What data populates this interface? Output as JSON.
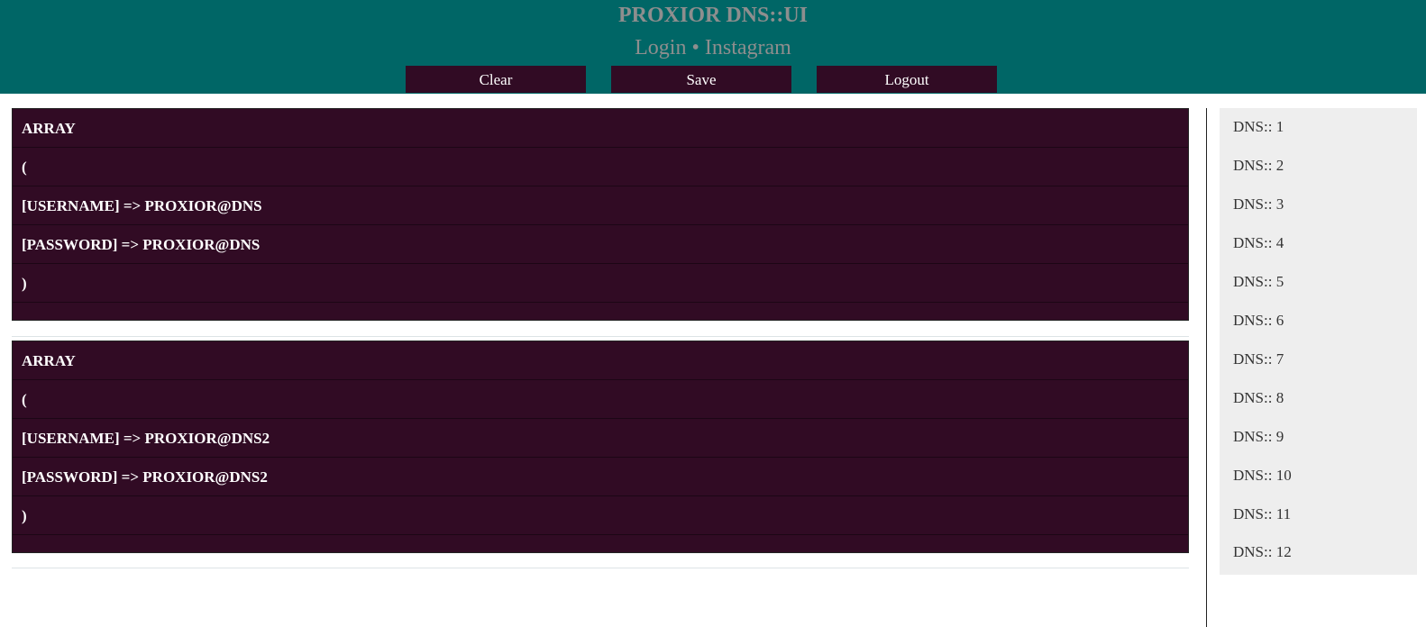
{
  "header": {
    "title": "PROXIOR DNS::UI",
    "subtitle": "Login • Instagram",
    "buttons": {
      "clear": "Clear",
      "save": "Save",
      "logout": "Logout"
    }
  },
  "records": [
    {
      "lines": [
        "ARRAY",
        "(",
        "[USERNAME] => PROXIOR@DNS",
        "[PASSWORD] => PROXIOR@DNS",
        ")"
      ]
    },
    {
      "lines": [
        "ARRAY",
        "(",
        "[USERNAME] => PROXIOR@DNS2",
        "[PASSWORD] => PROXIOR@DNS2",
        ")"
      ]
    }
  ],
  "sidebar": {
    "items": [
      "DNS:: 1",
      "DNS:: 2",
      "DNS:: 3",
      "DNS:: 4",
      "DNS:: 5",
      "DNS:: 6",
      "DNS:: 7",
      "DNS:: 8",
      "DNS:: 9",
      "DNS:: 10",
      "DNS:: 11",
      "DNS:: 12"
    ]
  },
  "colors": {
    "header_bg": "#006666",
    "block_bg": "#310b24",
    "sidebar_bg": "#eeeeee",
    "title_text": "#8e8e8e"
  }
}
